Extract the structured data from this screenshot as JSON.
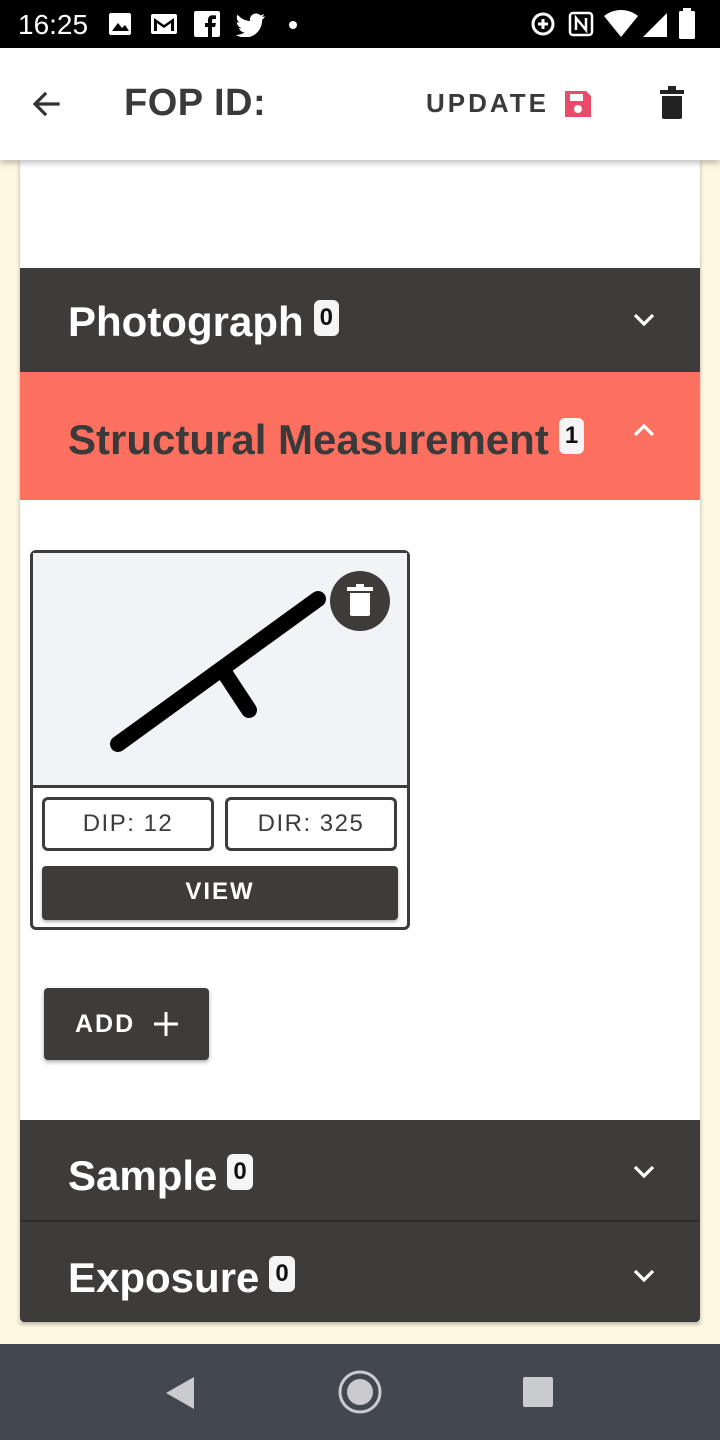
{
  "status_bar": {
    "time": "16:25",
    "left_icons": [
      "image-icon",
      "gmail-icon",
      "facebook-icon",
      "twitter-icon",
      "dot-icon"
    ],
    "right_icons": [
      "data-saver-icon",
      "nfc-icon",
      "wifi-icon",
      "signal-icon",
      "battery-icon"
    ]
  },
  "app_bar": {
    "title": "FOP ID:",
    "update_label": "UPDATE",
    "accent_color": "#e94c6b",
    "icons": [
      "back-arrow-icon",
      "save-icon",
      "trash-icon"
    ]
  },
  "sections": {
    "photograph": {
      "label": "Photograph",
      "count": "0",
      "expanded": false
    },
    "structural": {
      "label": "Structural Measurement",
      "count": "1",
      "expanded": true,
      "color": "#fd6f5f"
    },
    "sample": {
      "label": "Sample",
      "count": "0",
      "expanded": false
    },
    "exposure": {
      "label": "Exposure",
      "count": "0",
      "expanded": false
    }
  },
  "measurement_card": {
    "dip_label": "DIP: 12",
    "dir_label": "DIR: 325",
    "view_label": "VIEW",
    "symbol_icon": "strike-dip-symbol-icon"
  },
  "add_button": {
    "label": "ADD"
  },
  "colors": {
    "section_dark": "#3e3c3b",
    "background": "#fdf8e2",
    "nav_bar": "#434750"
  }
}
